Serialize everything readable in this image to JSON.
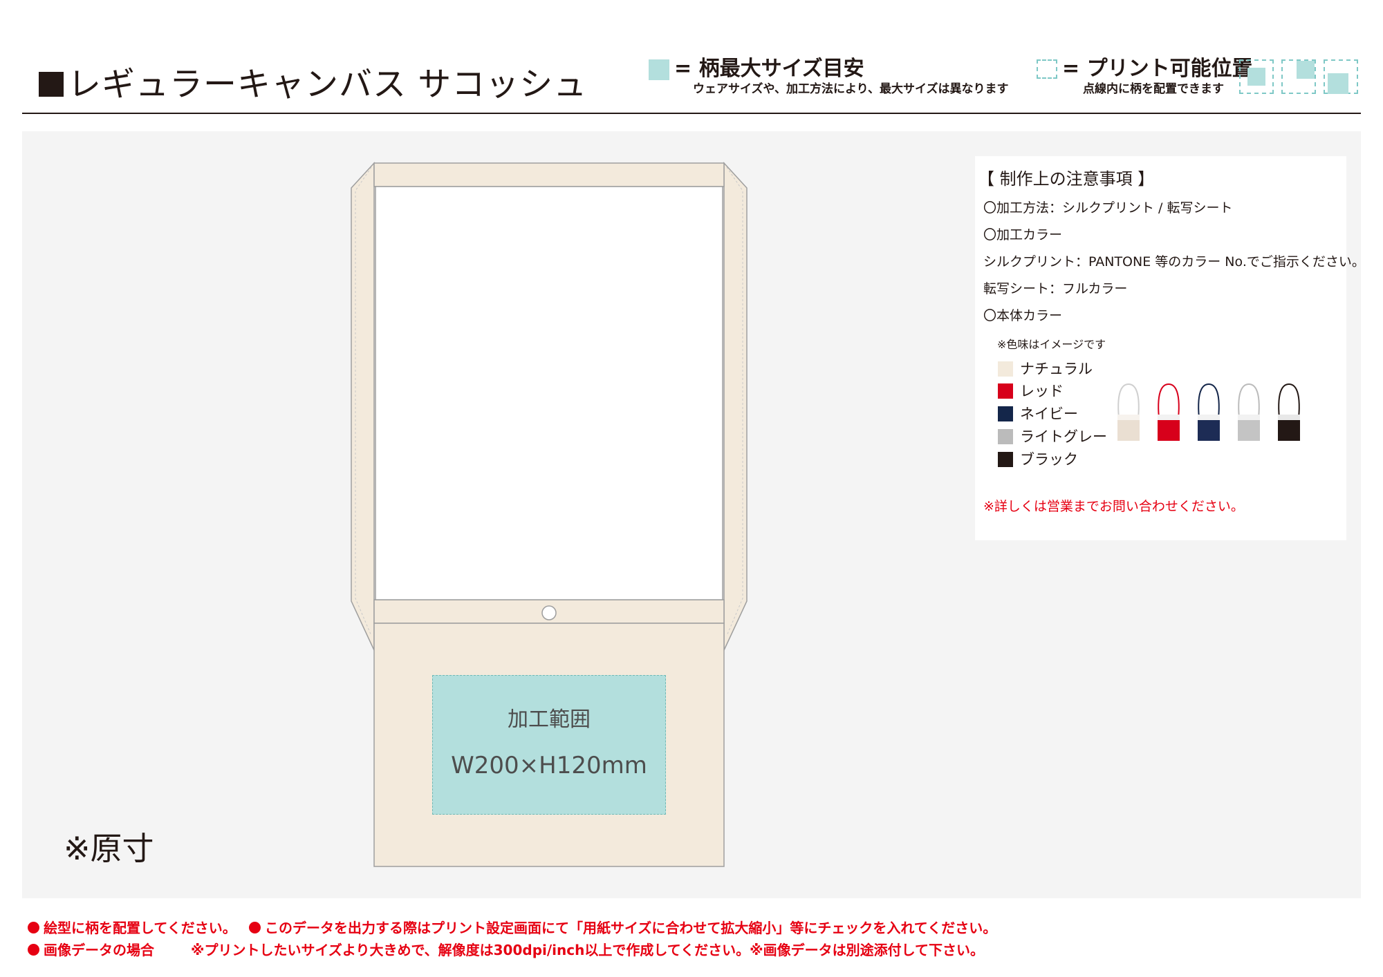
{
  "header": {
    "title": "レギュラーキャンバス サコッシュ",
    "legend_max": {
      "label": "= 柄最大サイズ目安",
      "sub": "ウェアサイズや、加工方法により、最大サイズは異なります",
      "color": "#b3dfdd"
    },
    "legend_print": {
      "label": "= プリント可能位置",
      "sub": "点線内に柄を配置できます",
      "color": "#7ec8c6"
    }
  },
  "template": {
    "print_area_label": "加工範囲",
    "print_area_size": "W200×H120mm",
    "scale_note": "※原寸",
    "bag_color": "#f3eadc",
    "print_area_color": "#b3dfdd"
  },
  "notes": {
    "heading": "【 制作上の注意事項 】",
    "method": "〇加工方法：シルクプリント / 転写シート",
    "process_color": "〇加工カラー",
    "silk": "シルクプリント：PANTONE 等のカラー No.でご指示ください。",
    "transfer": "転写シート：フルカラー",
    "body_color": "〇本体カラー",
    "tint_note": "※色味はイメージです",
    "colors": [
      {
        "name": "ナチュラル",
        "hex": "#f3eadc"
      },
      {
        "name": "レッド",
        "hex": "#d7001b"
      },
      {
        "name": "ネイビー",
        "hex": "#14264a"
      },
      {
        "name": "ライトグレー",
        "hex": "#bbbbbb"
      },
      {
        "name": "ブラック",
        "hex": "#231815"
      }
    ],
    "contact": "※詳しくは営業までお問い合わせください。"
  },
  "footer": {
    "line1a": "絵型に柄を配置してください。",
    "line1b": "このデータを出力する際はプリント設定画面にて「用紙サイズに合わせて拡大縮小」等にチェックを入れてください。",
    "line2a": "画像データの場合",
    "line2b": "※プリントしたいサイズより大きめで、解像度は300dpi/inch以上で作成してください。※画像データは別途添付して下さい。"
  }
}
